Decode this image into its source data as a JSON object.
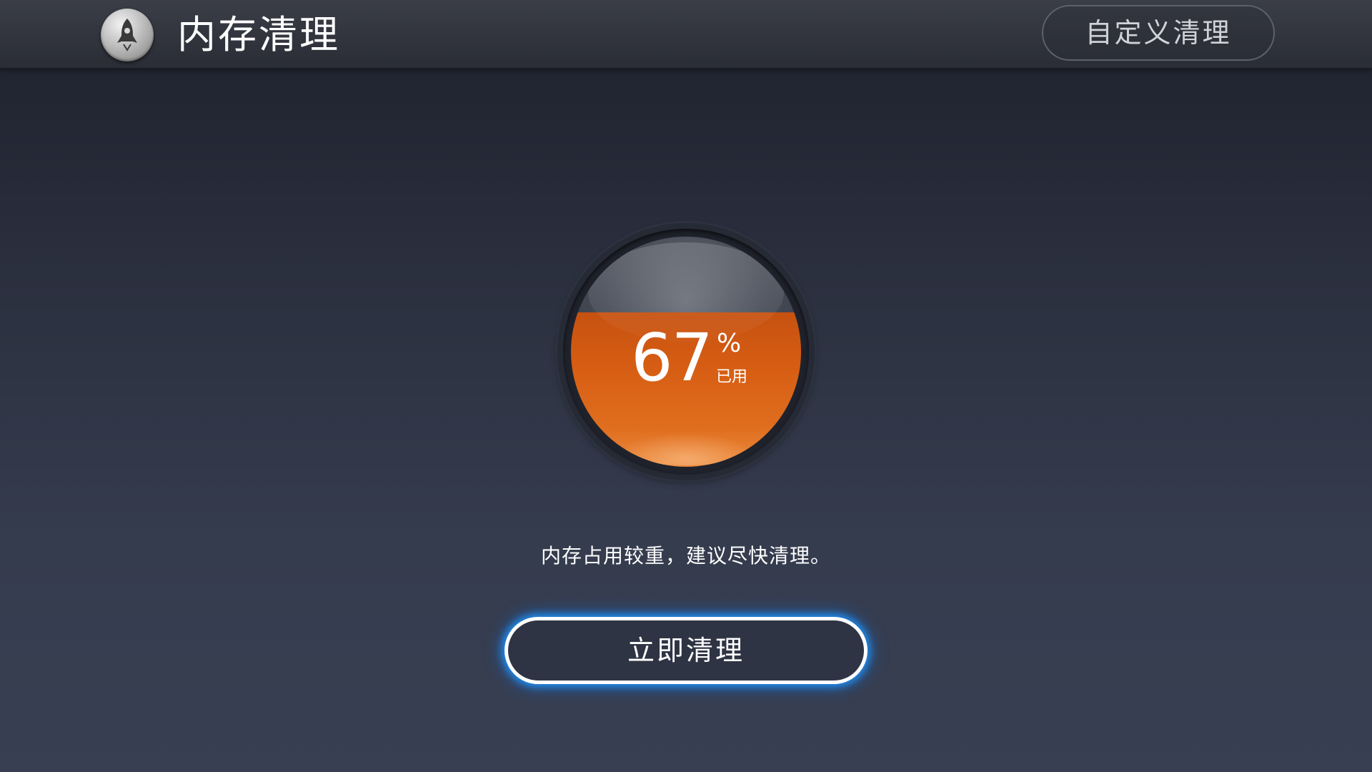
{
  "header": {
    "title": "内存清理",
    "app_icon": "rocket-icon",
    "custom_clean_label": "自定义清理"
  },
  "gauge": {
    "value": "67",
    "percent_sign": "%",
    "used_label": "已用",
    "fill_fraction": 0.67,
    "fill_color": "#d65d13"
  },
  "advice_text": "内存占用较重，建议尽快清理。",
  "clean_button": {
    "label": "立即清理",
    "glow_color": "#1e96ff"
  }
}
